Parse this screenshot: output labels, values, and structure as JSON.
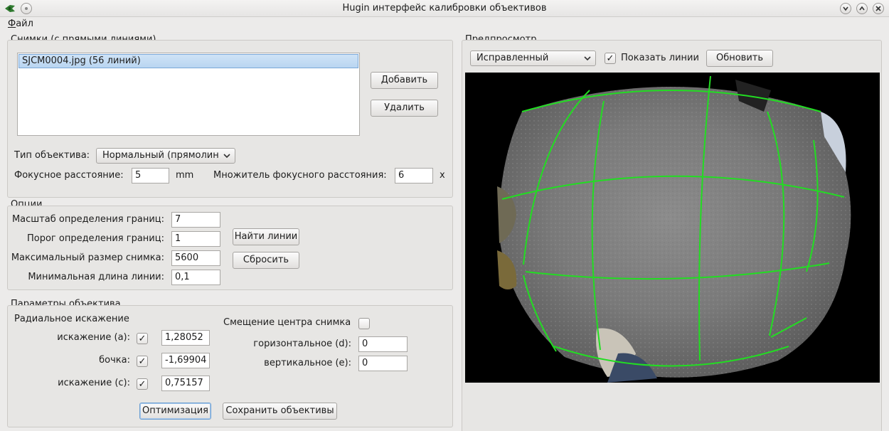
{
  "window": {
    "title": "Hugin интерфейс калибровки объективов"
  },
  "menu": {
    "file_prefix": "Ф",
    "file_rest": "айл"
  },
  "images": {
    "title": "Снимки (с прямыми линиями)",
    "items": [
      "SJCM0004.jpg (56 линий)"
    ],
    "add_label": "Добавить",
    "remove_label": "Удалить",
    "lens_type_label": "Тип объектива:",
    "lens_type_value": "Нормальный (прямолин",
    "focal_label": "Фокусное расстояние:",
    "focal_value": "5",
    "focal_unit": "mm",
    "crop_label": "Множитель фокусного расстояния:",
    "crop_value": "6",
    "crop_unit": "x"
  },
  "options": {
    "title": "Опции",
    "edge_scale_label": "Масштаб определения границ:",
    "edge_scale_value": "7",
    "edge_threshold_label": "Порог определения границ:",
    "edge_threshold_value": "1",
    "max_size_label": "Максимальный размер снимка:",
    "max_size_value": "5600",
    "min_line_label": "Минимальная длина линии:",
    "min_line_value": "0,1",
    "find_lines_label": "Найти линии",
    "reset_label": "Сбросить"
  },
  "lens_params": {
    "title": "Параметры объектива",
    "radial_label": "Радиальное искажение",
    "a_label": "искажение (a):",
    "a_checked": true,
    "a_value": "1,28052",
    "b_label": "бочка:",
    "b_checked": true,
    "b_value": "-1,69904",
    "c_label": "искажение (c):",
    "c_checked": true,
    "c_value": "0,75157",
    "shift_label": "Смещение центра снимка",
    "shift_checked": false,
    "d_label": "горизонтальное (d):",
    "d_value": "0",
    "e_label": "вертикальное (e):",
    "e_value": "0",
    "optimize_label": "Оптимизация",
    "save_label": "Сохранить объективы"
  },
  "preview": {
    "title": "Предпросмотр",
    "mode_value": "Исправленный",
    "show_lines_checked": true,
    "show_lines_label": "Показать линии",
    "update_label": "Обновить"
  },
  "colors": {
    "line_overlay": "#22dd22",
    "selection": "#b9d5f1"
  },
  "icons": {
    "app": "hugin-logo-icon",
    "menu": "circle-menu-icon",
    "minimize": "chevron-down-icon",
    "maximize": "chevron-up-icon",
    "close": "close-icon",
    "dropdown": "chevron-down-icon",
    "check": "checkmark-icon"
  }
}
